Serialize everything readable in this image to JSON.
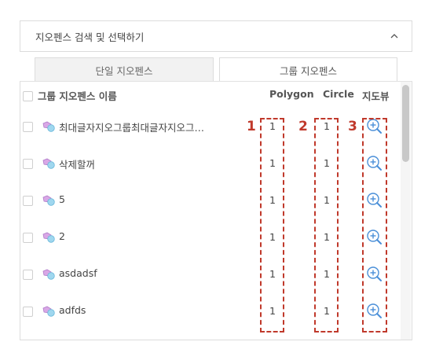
{
  "panel": {
    "title": "지오펜스 검색 및 선택하기",
    "collapse_icon": "chevron-up-icon"
  },
  "tabs": [
    {
      "label": "단일 지오펜스",
      "active": false
    },
    {
      "label": "그룹 지오펜스",
      "active": true
    }
  ],
  "table": {
    "headers": {
      "name": "그룹 지오펜스 이름",
      "polygon": "Polygon",
      "circle": "Circle",
      "map_view": "지도뷰"
    },
    "rows": [
      {
        "name": "최대글자지오그룹최대글자지오그…",
        "polygon": "1",
        "circle": "1",
        "icon": "geofence-group-icon",
        "action_icon": "zoom-in-icon"
      },
      {
        "name": "삭제할꺼",
        "polygon": "1",
        "circle": "1",
        "icon": "geofence-group-icon",
        "action_icon": "zoom-in-icon"
      },
      {
        "name": "5",
        "polygon": "1",
        "circle": "1",
        "icon": "geofence-group-icon",
        "action_icon": "zoom-in-icon"
      },
      {
        "name": "2",
        "polygon": "1",
        "circle": "1",
        "icon": "geofence-group-icon",
        "action_icon": "zoom-in-icon"
      },
      {
        "name": "asdadsf",
        "polygon": "1",
        "circle": "1",
        "icon": "geofence-group-icon",
        "action_icon": "zoom-in-icon"
      },
      {
        "name": "adfds",
        "polygon": "1",
        "circle": "1",
        "icon": "geofence-group-icon",
        "action_icon": "zoom-in-icon"
      }
    ]
  },
  "annotations": [
    "1",
    "2",
    "3"
  ],
  "colors": {
    "annotation": "#c0392b",
    "zoom_icon": "#4a8fd8",
    "border": "#dcdcdc"
  }
}
